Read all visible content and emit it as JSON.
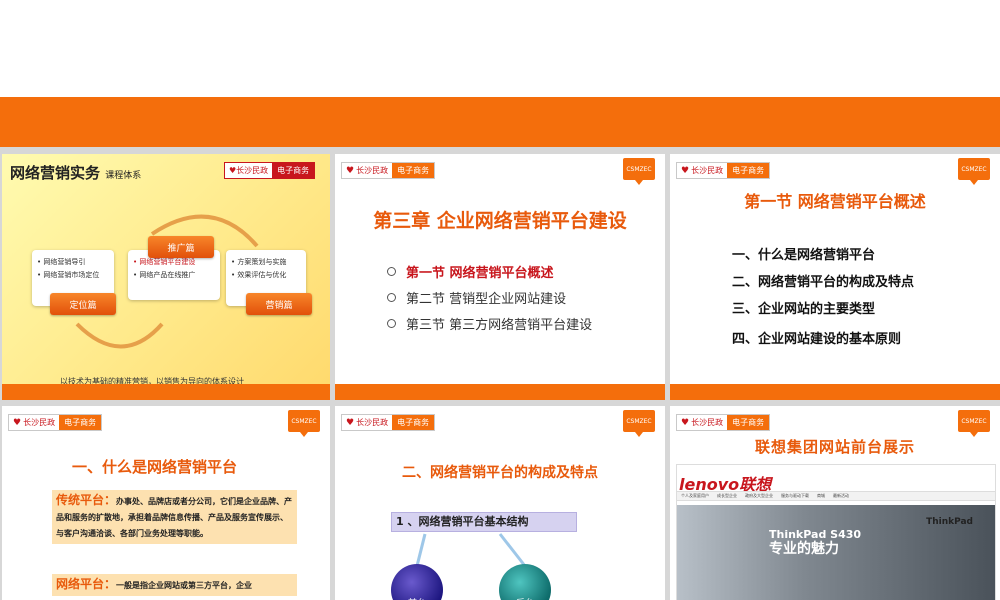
{
  "brand": {
    "org": "长沙民政",
    "ec": "电子商务",
    "badge": "CSMZEC",
    "heart": "♥"
  },
  "colors": {
    "accent": "#f46e0c",
    "red": "#c8161d"
  },
  "slide1": {
    "title": "网络营销实务",
    "subtitle": "课程体系",
    "left_items": [
      "网络营销导引",
      "网络营销市场定位"
    ],
    "left_pill": "定位篇",
    "mid_pill": "推广篇",
    "mid_items": [
      "网络营销平台建设",
      "网络产品在线推广"
    ],
    "right_items": [
      "方案策划与实施",
      "效果评估与优化"
    ],
    "right_pill": "营销篇",
    "footer": "以技术为基础的精准营销，以销售为导向的体系设计"
  },
  "slide2": {
    "title": "第三章   企业网络营销平台建设",
    "items": [
      {
        "label": "第一节  网络营销平台概述",
        "active": true
      },
      {
        "label": "第二节  营销型企业网站建设",
        "active": false
      },
      {
        "label": "第三节  第三方网络营销平台建设",
        "active": false
      }
    ]
  },
  "slide3": {
    "title": "第一节   网络营销平台概述",
    "items": [
      "一、什么是网络营销平台",
      "二、网络营销平台的构成及特点",
      "三、企业网站的主要类型",
      "四、企业网站建设的基本原则"
    ]
  },
  "slide4": {
    "title": "一、什么是网络营销平台",
    "box1_lead": "传统平台：",
    "box1_text": "办事处、品牌店或者分公司，它们是企业品牌、产品和服务的扩散地，承担着品牌信息传播、产品及服务宣传展示、与客户沟通洽谈、各部门业务处理等职能。",
    "box2_lead": "网络平台：",
    "box2_text": "一般是指企业网站或第三方平台，企业"
  },
  "slide5": {
    "title": "二、网络营销平台的构成及特点",
    "box": "1 、网络营销平台基本结构",
    "ball_left": "前台",
    "ball_right": "后台"
  },
  "slide6": {
    "title": "联想集团网站前台展示",
    "logo": "lenovo联想",
    "nav": [
      "个人及家庭用户",
      "成长型企业",
      "政府及大型企业",
      "服务与驱动下载",
      "商城",
      "最新活动"
    ],
    "hero_brand": "ThinkPad S430",
    "hero_slogan": "专业的魅力",
    "thinkpad": "ThinkPad"
  }
}
